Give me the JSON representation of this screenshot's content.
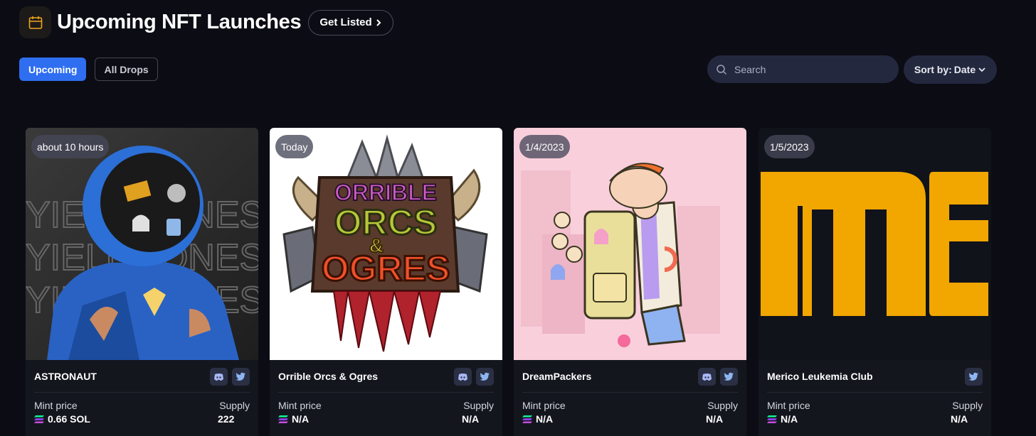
{
  "header": {
    "title": "Upcoming NFT Launches",
    "get_listed_label": "Get Listed",
    "icons": {
      "calendar": "calendar-icon",
      "chevron": "chevron-right-icon"
    },
    "accent": "#f2a51a"
  },
  "filters": {
    "upcoming_label": "Upcoming",
    "all_drops_label": "All Drops",
    "active": "Upcoming",
    "active_color": "#2f6ef0"
  },
  "search": {
    "placeholder": "Search"
  },
  "sort": {
    "label": "Sort by:",
    "value": "Date"
  },
  "cards": [
    {
      "badge": "about 10 hours",
      "name": "ASTRONAUT",
      "mint_label": "Mint price",
      "mint_value": "0.66 SOL",
      "supply_label": "Supply",
      "supply_value": "222",
      "art_text": "YIELDNONES"
    },
    {
      "badge": "Today",
      "name": "Orrible Orcs & Ogres",
      "mint_label": "Mint price",
      "mint_value": "N/A",
      "supply_label": "Supply",
      "supply_value": "N/A",
      "art_text": [
        "ORRIBLE",
        "ORCS",
        "&",
        "OGRES"
      ]
    },
    {
      "badge": "1/4/2023",
      "name": "DreamPackers",
      "mint_label": "Mint price",
      "mint_value": "N/A",
      "supply_label": "Supply",
      "supply_value": "N/A"
    },
    {
      "badge": "1/5/2023",
      "name": "Merico Leukemia Club",
      "mint_label": "Mint price",
      "mint_value": "N/A",
      "supply_label": "Supply",
      "supply_value": "N/A"
    }
  ]
}
